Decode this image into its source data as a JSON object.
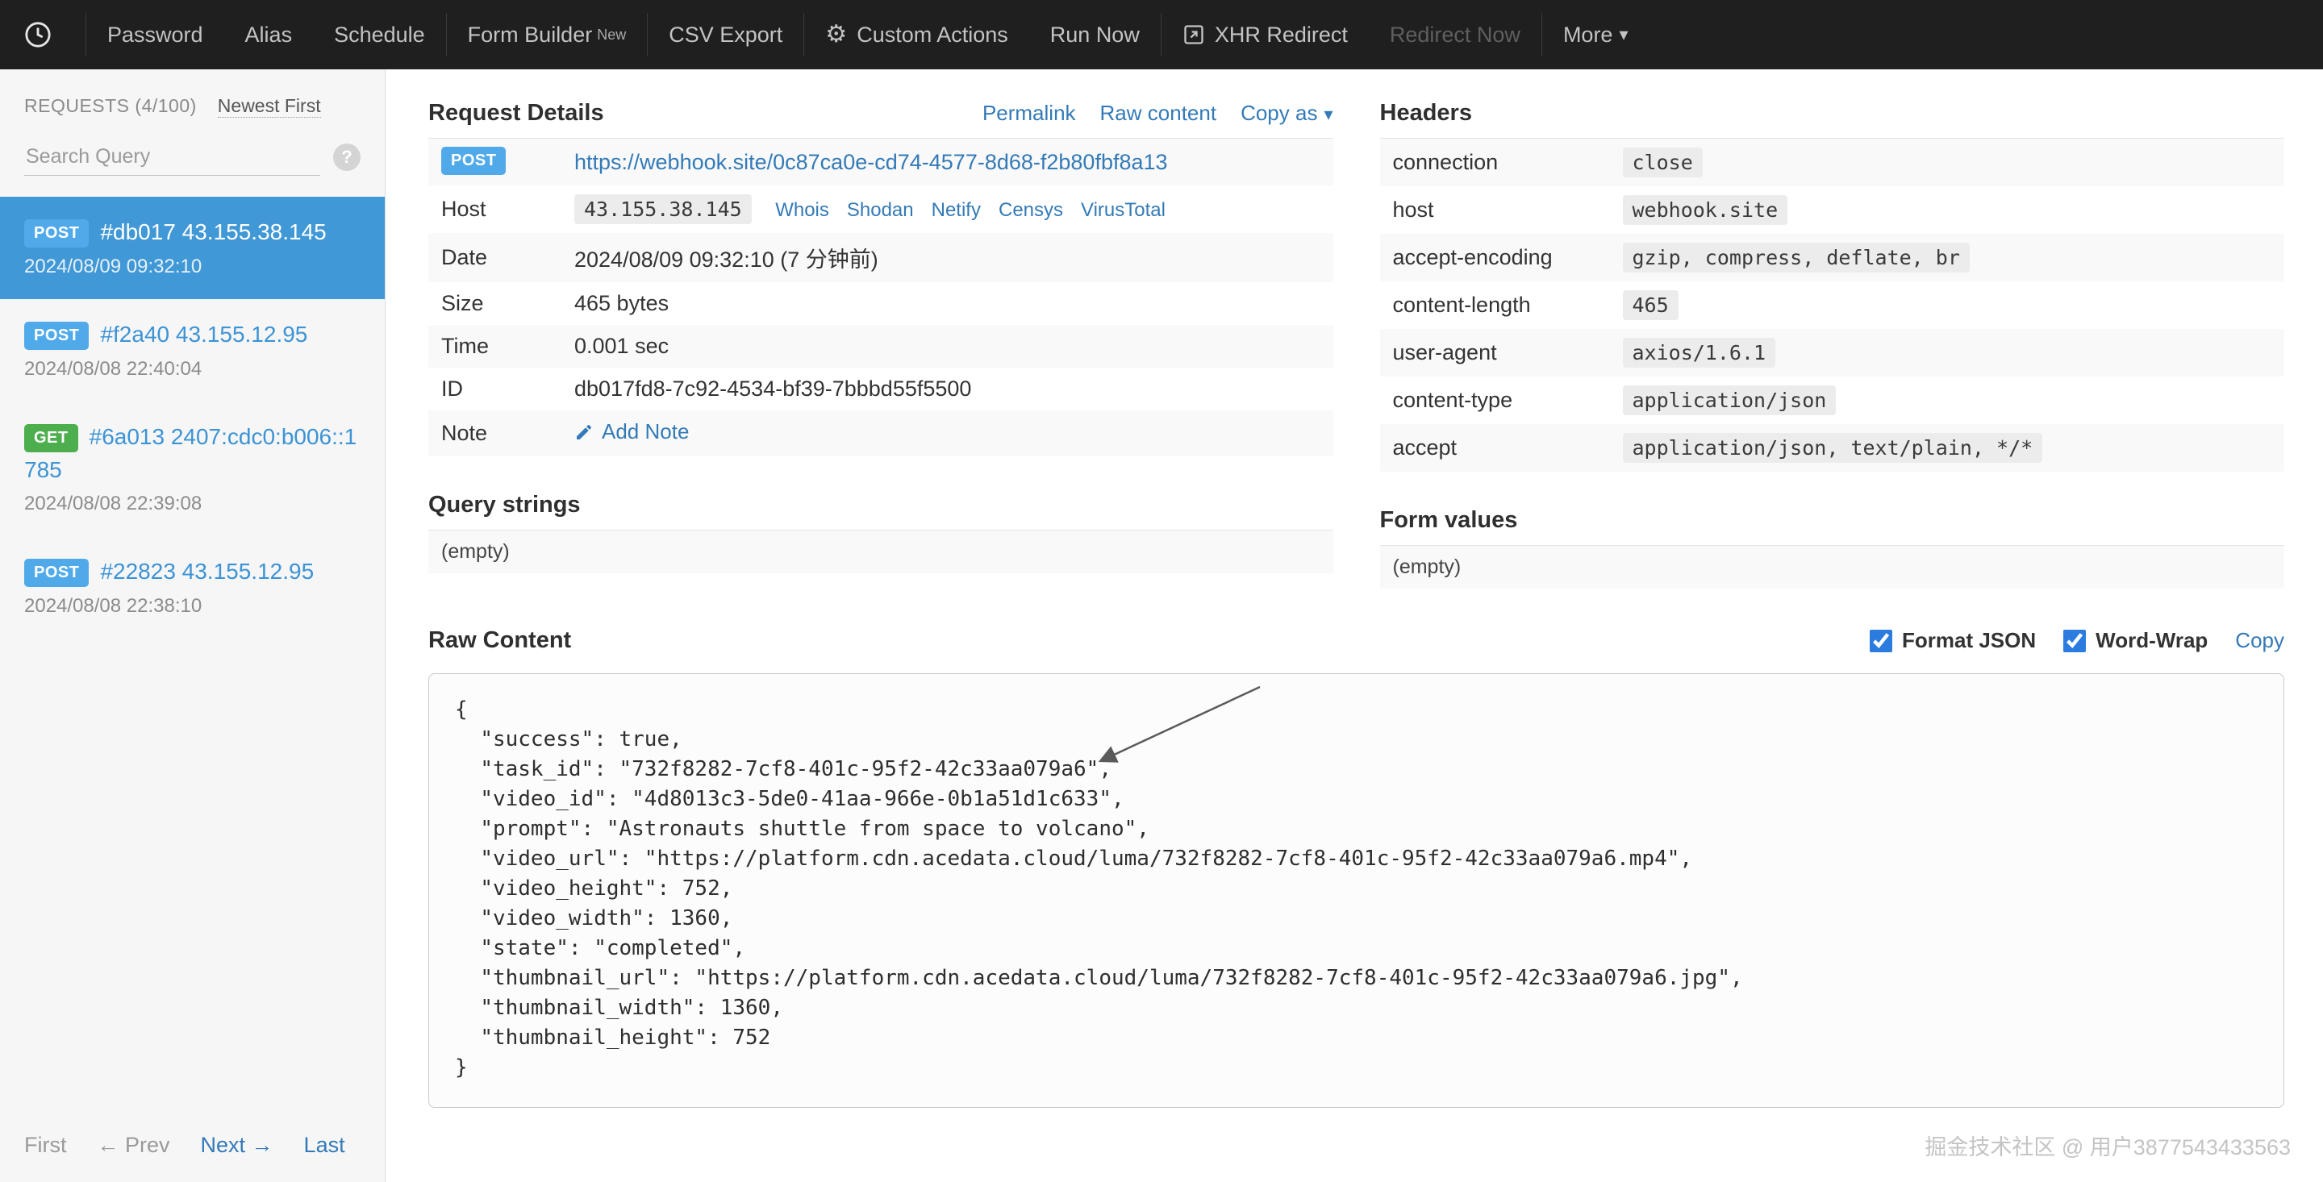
{
  "colors": {
    "navbar_bg": "#1f1f1f",
    "accent_link": "#337ab7",
    "post_badge": "#50aaea",
    "get_badge": "#4cae4c",
    "selected_request_bg": "#4198d6",
    "checkbox_accent": "#2b7cdf"
  },
  "navbar": {
    "password": "Password",
    "alias": "Alias",
    "schedule": "Schedule",
    "form_builder": "Form Builder",
    "form_builder_badge": "New",
    "csv_export": "CSV Export",
    "custom_actions": "Custom Actions",
    "run_now": "Run Now",
    "xhr_redirect": "XHR Redirect",
    "redirect_now": "Redirect Now",
    "more": "More"
  },
  "sidebar": {
    "title": "REQUESTS (4/100)",
    "sort": "Newest First",
    "search_placeholder": "Search Query",
    "requests": [
      {
        "method": "POST",
        "label": "#db017 43.155.38.145",
        "time": "2024/08/09 09:32:10"
      },
      {
        "method": "POST",
        "label": "#f2a40 43.155.12.95",
        "time": "2024/08/08 22:40:04"
      },
      {
        "method": "GET",
        "label": "#6a013 2407:cdc0:b006::1785",
        "time": "2024/08/08 22:39:08"
      },
      {
        "method": "POST",
        "label": "#22823 43.155.12.95",
        "time": "2024/08/08 22:38:10"
      }
    ],
    "pagination": {
      "first": "First",
      "prev": "← Prev",
      "next": "Next →",
      "last": "Last"
    }
  },
  "details": {
    "title": "Request Details",
    "permalink": "Permalink",
    "raw_content_link": "Raw content",
    "copy_as": "Copy as",
    "method": "POST",
    "url": "https://webhook.site/0c87ca0e-cd74-4577-8d68-f2b80fbf8a13",
    "host_label": "Host",
    "host_value": "43.155.38.145",
    "host_links": [
      "Whois",
      "Shodan",
      "Netify",
      "Censys",
      "VirusTotal"
    ],
    "date_label": "Date",
    "date_value": "2024/08/09 09:32:10 (7 分钟前)",
    "size_label": "Size",
    "size_value": "465 bytes",
    "time_label": "Time",
    "time_value": "0.001 sec",
    "id_label": "ID",
    "id_value": "db017fd8-7c92-4534-bf39-7bbbd55f5500",
    "note_label": "Note",
    "note_action": "Add Note"
  },
  "query_strings": {
    "title": "Query strings",
    "empty": "(empty)"
  },
  "headers": {
    "title": "Headers",
    "rows": [
      {
        "name": "connection",
        "value": "close"
      },
      {
        "name": "host",
        "value": "webhook.site"
      },
      {
        "name": "accept-encoding",
        "value": "gzip, compress, deflate, br"
      },
      {
        "name": "content-length",
        "value": "465"
      },
      {
        "name": "user-agent",
        "value": "axios/1.6.1"
      },
      {
        "name": "content-type",
        "value": "application/json"
      },
      {
        "name": "accept",
        "value": "application/json, text/plain, */*"
      }
    ]
  },
  "form_values": {
    "title": "Form values",
    "empty": "(empty)"
  },
  "raw_content": {
    "title": "Raw Content",
    "format_json_label": "Format JSON",
    "word_wrap_label": "Word-Wrap",
    "copy_label": "Copy",
    "body": "{\n  \"success\": true,\n  \"task_id\": \"732f8282-7cf8-401c-95f2-42c33aa079a6\",\n  \"video_id\": \"4d8013c3-5de0-41aa-966e-0b1a51d1c633\",\n  \"prompt\": \"Astronauts shuttle from space to volcano\",\n  \"video_url\": \"https://platform.cdn.acedata.cloud/luma/732f8282-7cf8-401c-95f2-42c33aa079a6.mp4\",\n  \"video_height\": 752,\n  \"video_width\": 1360,\n  \"state\": \"completed\",\n  \"thumbnail_url\": \"https://platform.cdn.acedata.cloud/luma/732f8282-7cf8-401c-95f2-42c33aa079a6.jpg\",\n  \"thumbnail_width\": 1360,\n  \"thumbnail_height\": 752\n}"
  },
  "watermark": "掘金技术社区 @ 用户3877543433563"
}
